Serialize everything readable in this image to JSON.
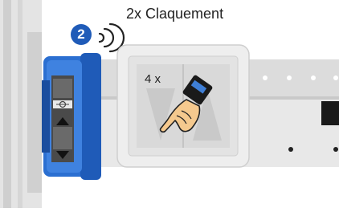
{
  "instruction": {
    "step_number": "2",
    "action_label": "2x Claquement",
    "press_count_label": "4 x"
  },
  "icons": {
    "step_badge": "numbered-circle-icon",
    "sound": "sound-waves-icon",
    "hand": "pointing-hand-icon",
    "drive": "tubular-motor-end-icon",
    "switch": "double-wall-switch-icon"
  },
  "colors": {
    "badge_blue": "#1f5bb8",
    "motor_blue": "#2b6fd1",
    "rail_gray": "#dcdcdc",
    "switch_frame": "#eeeeee",
    "hand_skin": "#f5c98e",
    "cuff_blue": "#3f7fd6"
  }
}
